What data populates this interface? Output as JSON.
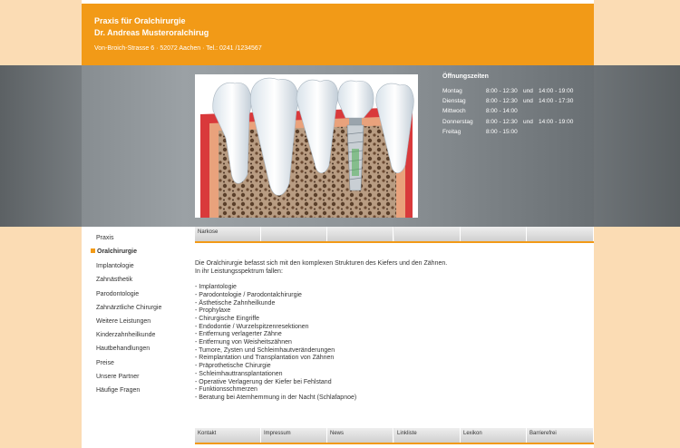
{
  "header": {
    "line1": "Praxis für Oralchirurgie",
    "line2": "Dr. Andreas Musteroralchirug",
    "address": "Von-Broich-Strasse 6 · 52072 Aachen · Tel.: 0241 /1234567"
  },
  "colors": {
    "accent": "#f29a17",
    "page_bg": "#fbdcb4",
    "band_gray": "#8c9296"
  },
  "hero": {
    "image": "dental-implant-illustration"
  },
  "hours": {
    "title": "Öffnungszeiten",
    "rows": [
      {
        "day": "Montag",
        "t1": "8:00 - 12:30",
        "und": "und",
        "t2": "14:00 - 19:00"
      },
      {
        "day": "Dienstag",
        "t1": "8:00 - 12:30",
        "und": "und",
        "t2": "14:00 - 17:30"
      },
      {
        "day": "Mittwoch",
        "t1": "8:00 - 14:00",
        "und": "",
        "t2": ""
      },
      {
        "day": "Donnerstag",
        "t1": "8:00 - 12:30",
        "und": "und",
        "t2": "14:00 - 19:00"
      },
      {
        "day": "Freitag",
        "t1": "8:00 - 15:00",
        "und": "",
        "t2": ""
      }
    ]
  },
  "sidebar": {
    "items": [
      {
        "label": "Praxis",
        "active": false
      },
      {
        "label": "Oralchirurgie",
        "active": true
      },
      {
        "label": "Implantologie",
        "active": false
      },
      {
        "label": "Zahnästhetik",
        "active": false
      },
      {
        "label": "Parodontologie",
        "active": false
      },
      {
        "label": "Zahnärztliche Chirurgie",
        "active": false
      },
      {
        "label": "Weitere Leistungen",
        "active": false
      },
      {
        "label": "Kinderzahnheilkunde",
        "active": false
      },
      {
        "label": "Hautbehandlungen",
        "active": false
      },
      {
        "label": "Preise",
        "active": false
      },
      {
        "label": "Unsere Partner",
        "active": false
      },
      {
        "label": "Häufige Fragen",
        "active": false
      }
    ]
  },
  "topnav": {
    "items": [
      "Narkose",
      "",
      "",
      "",
      "",
      ""
    ]
  },
  "bottomnav": {
    "items": [
      "Kontakt",
      "Impressum",
      "News",
      "Linkliste",
      "Lexikon",
      "Barrierefrei"
    ]
  },
  "content": {
    "intro1": "Die Oralchirurgie befasst sich mit den komplexen Strukturen des Kiefers und den Zähnen.",
    "intro2": "In ihr Leistungsspektrum fallen:",
    "list": [
      "- Implantologie",
      "- Parodontologie / Parodontalchirurgie",
      "- Ästhetische Zahnheilkunde",
      "- Prophylaxe",
      "- Chirurgische Eingriffe",
      "- Endodontie / Wurzelspitzenresektionen",
      "- Entfernung verlagerter Zähne",
      "- Entfernung von Weisheitszähnen",
      "- Tumore, Zysten und Schleimhautveränderungen",
      "- Reimplantation und Transplantation von Zähnen",
      "- Präprothetische Chirurgie",
      "- Schleimhauttransplantationen",
      "- Operative Verlagerung der Kiefer bei Fehlstand",
      "- Funktionsschmerzen",
      "- Beratung bei Atemhemmung in der Nacht (Schlafapnoe)"
    ]
  }
}
